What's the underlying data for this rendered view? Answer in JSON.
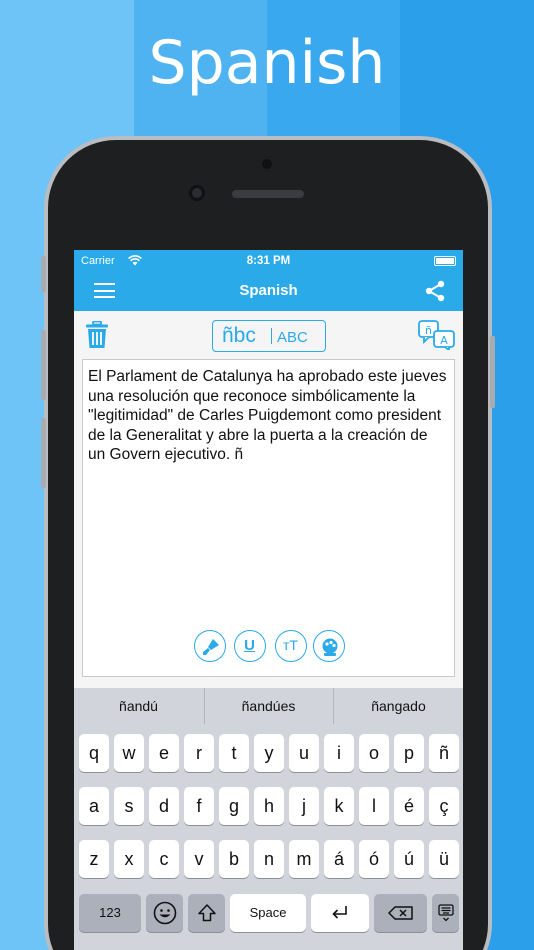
{
  "promo": {
    "headline": "Spanish"
  },
  "status_bar": {
    "carrier": "Carrier",
    "time": "8:31 PM"
  },
  "app_bar": {
    "title": "Spanish"
  },
  "toolbar": {
    "keyboard_toggle_left": "ñbc",
    "keyboard_toggle_right": "ABC"
  },
  "editor": {
    "text": "El Parlament de Catalunya ha aprobado este jueves una resolución que reconoce simbólicamente la \"legitimidad\" de Carles Puigdemont como president de la Generalitat y abre la puerta a la creación de un Govern ejecutivo. ñ"
  },
  "format_buttons": {
    "underline": "U",
    "text_size": "тT"
  },
  "suggestions": [
    "ñandú",
    "ñandúes",
    "ñangado"
  ],
  "keyboard": {
    "row1": [
      "q",
      "w",
      "e",
      "r",
      "t",
      "y",
      "u",
      "i",
      "o",
      "p",
      "ñ"
    ],
    "row2": [
      "a",
      "s",
      "d",
      "f",
      "g",
      "h",
      "j",
      "k",
      "l",
      "é",
      "ç"
    ],
    "row3": [
      "z",
      "x",
      "c",
      "v",
      "b",
      "n",
      "m",
      "á",
      "ó",
      "ú",
      "ü"
    ],
    "numbers_key": "123",
    "space_key": "Space"
  },
  "colors": {
    "accent": "#2aaae9",
    "background": "#2aa1ea"
  }
}
